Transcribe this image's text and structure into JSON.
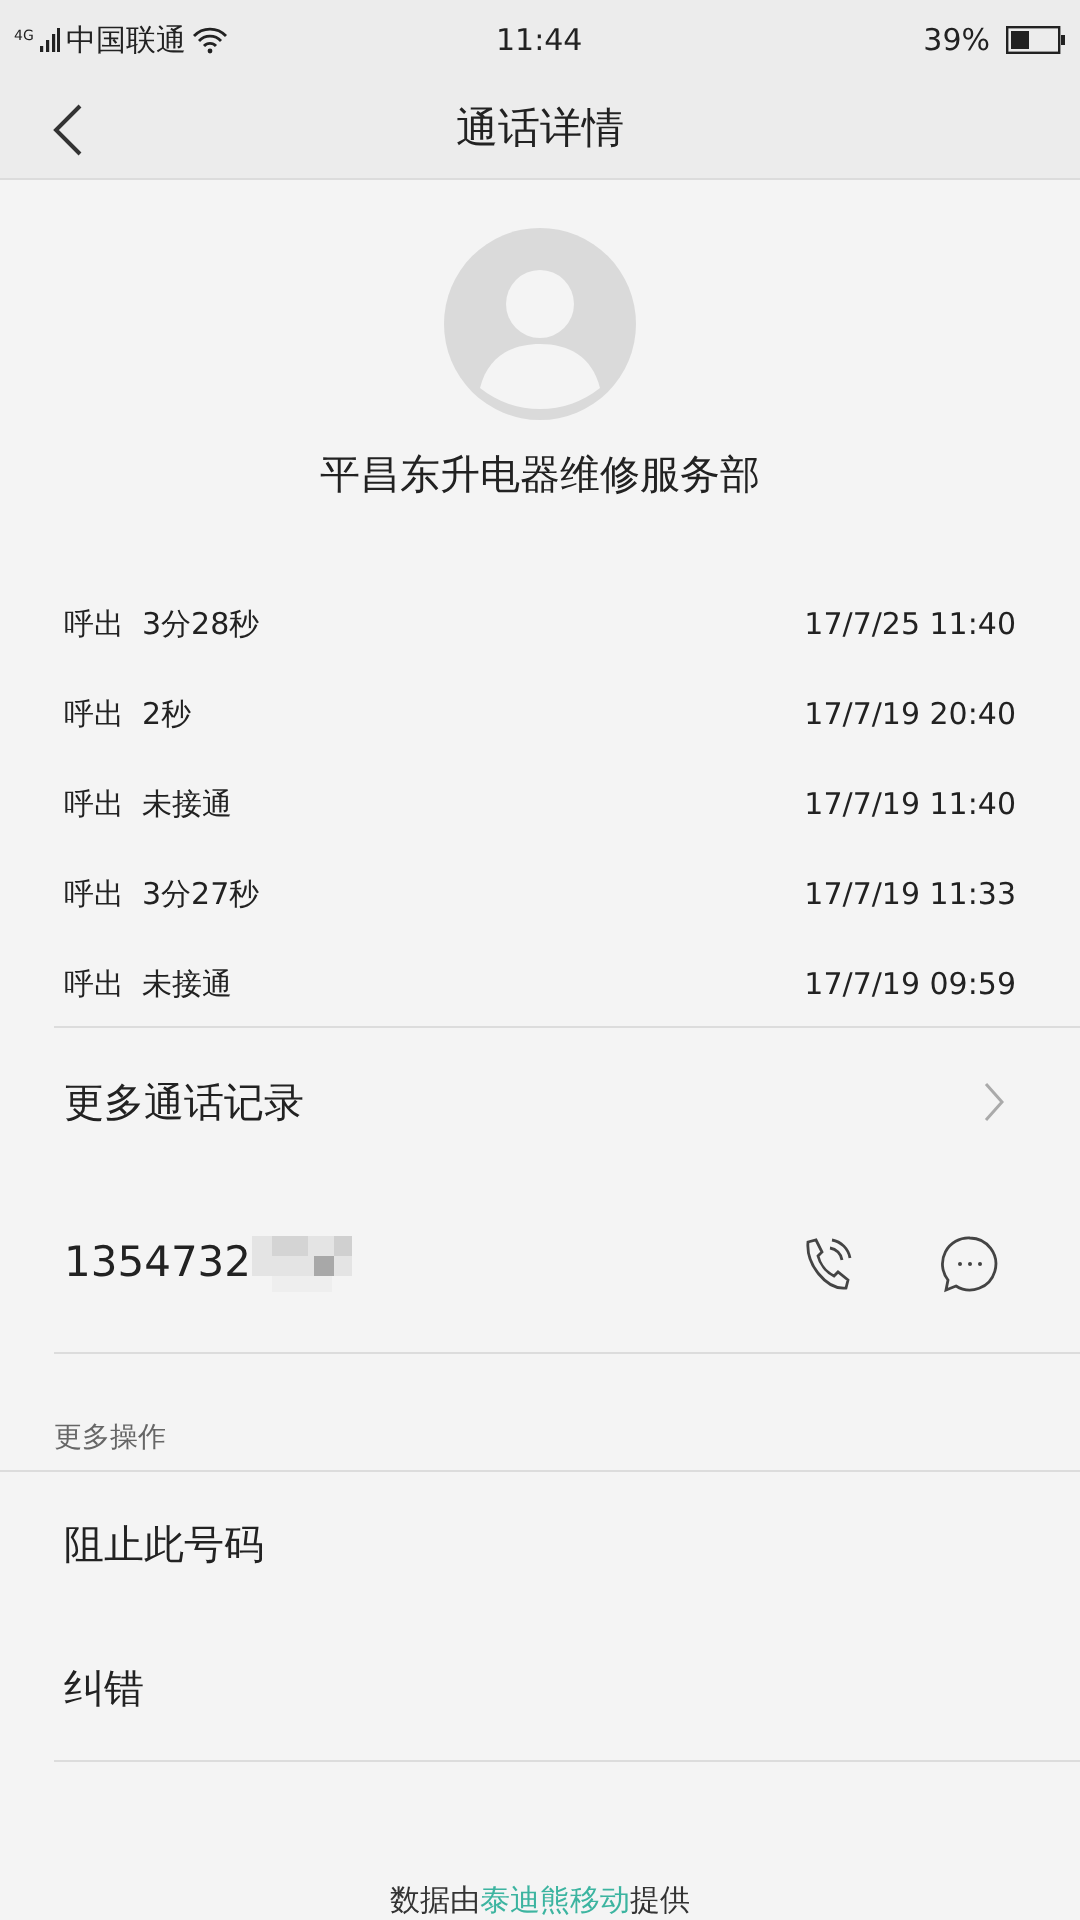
{
  "status_bar": {
    "network": "4G",
    "carrier": "中国联通",
    "time": "11:44",
    "battery": "39%"
  },
  "header": {
    "title": "通话详情"
  },
  "contact": {
    "name": "平昌东升电器维修服务部"
  },
  "calls": [
    {
      "type": "呼出",
      "duration": "3分28秒",
      "time": "17/7/25 11:40"
    },
    {
      "type": "呼出",
      "duration": "2秒",
      "time": "17/7/19 20:40"
    },
    {
      "type": "呼出",
      "duration": "未接通",
      "time": "17/7/19 11:40"
    },
    {
      "type": "呼出",
      "duration": "3分27秒",
      "time": "17/7/19 11:33"
    },
    {
      "type": "呼出",
      "duration": "未接通",
      "time": "17/7/19 09:59"
    }
  ],
  "more_calls": "更多通话记录",
  "number": "1354732",
  "more_actions": {
    "heading": "更多操作",
    "items": [
      "阻止此号码",
      "纠错"
    ]
  },
  "footer": {
    "before": "数据由",
    "link": "泰迪熊移动",
    "after": "提供"
  }
}
